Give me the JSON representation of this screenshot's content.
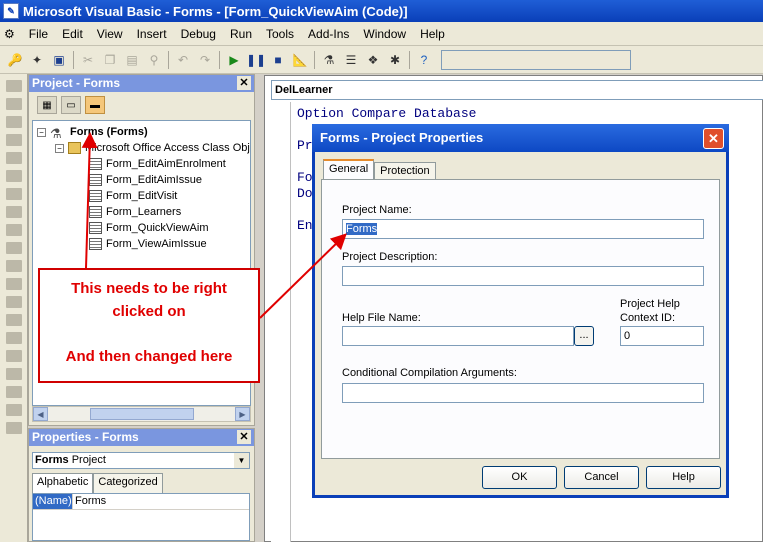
{
  "window": {
    "title": "Microsoft Visual Basic - Forms - [Form_QuickViewAim (Code)]"
  },
  "menu": [
    "File",
    "Edit",
    "View",
    "Insert",
    "Debug",
    "Run",
    "Tools",
    "Add-Ins",
    "Window",
    "Help"
  ],
  "toolbar_icons": [
    "access-icon",
    "add-module-icon",
    "save-icon",
    "cut-icon",
    "copy-icon",
    "paste-icon",
    "find-icon",
    "undo-icon",
    "redo-icon",
    "run-icon",
    "break-icon",
    "reset-icon",
    "design-mode-icon",
    "project-explorer-icon",
    "properties-icon",
    "object-browser-icon",
    "toolbox-icon",
    "help-icon"
  ],
  "project_panel": {
    "title": "Project - Forms",
    "root": "Forms (Forms)",
    "folder": "Microsoft Office Access Class Obje",
    "items": [
      "Form_EditAimEnrolment",
      "Form_EditAimIssue",
      "Form_EditVisit",
      "Form_Learners",
      "Form_QuickViewAim",
      "Form_ViewAimIssue"
    ]
  },
  "properties_panel": {
    "title": "Properties - Forms",
    "object_name": "Forms",
    "object_type": "Project",
    "tabs": [
      "Alphabetic",
      "Categorized"
    ],
    "prop_name": "(Name)",
    "prop_value": "Forms"
  },
  "code_window": {
    "object_selector": "DelLearner",
    "lines": [
      "Option Compare Database",
      "Pr",
      "Fo",
      "Do",
      "En"
    ]
  },
  "dialog": {
    "title": "Forms - Project Properties",
    "tabs": [
      "General",
      "Protection"
    ],
    "project_name_label": "Project Name:",
    "project_name": "Forms",
    "project_description_label": "Project Description:",
    "project_description": "",
    "help_file_label": "Help File Name:",
    "help_file": "",
    "browse_label": "...",
    "help_context_label_1": "Project Help",
    "help_context_label_2": "Context ID:",
    "help_context_id": "0",
    "cond_args_label": "Conditional Compilation Arguments:",
    "cond_args": "",
    "ok": "OK",
    "cancel": "Cancel",
    "help": "Help"
  },
  "annotation": {
    "line1": "This needs to be right",
    "line2": "clicked on",
    "line3": "And then changed here",
    "color": "#e00000"
  }
}
